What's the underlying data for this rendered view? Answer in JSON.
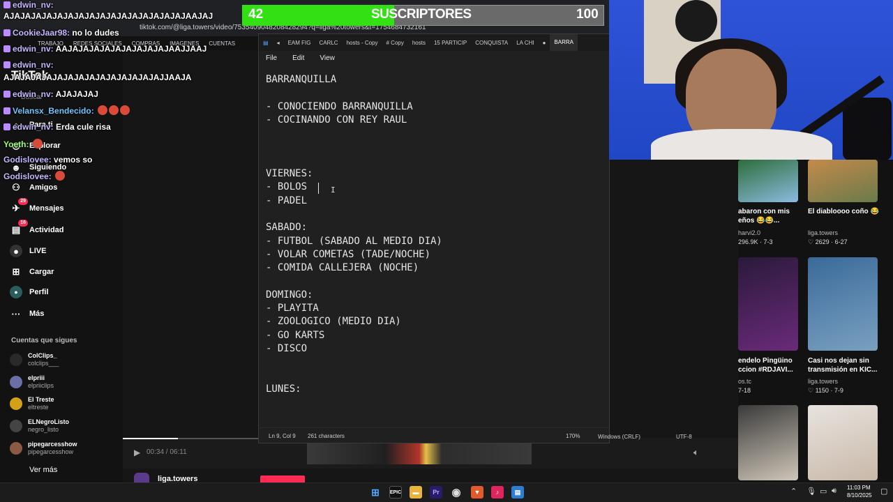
{
  "browser": {
    "url": "tiktok.com/@liga.towers/video/7535409048208428294?q=liga%20towers&t=1754684732161",
    "bookmarks": [
      "TRABAJO",
      "REDES SOCIALES",
      "COMPRAS",
      "IMAGENES",
      "CUENTAS"
    ]
  },
  "tiktok_sidebar": {
    "logo": "TikTok",
    "search_placeholder": "Buscar",
    "nav": [
      {
        "label": "Para ti",
        "icon": "home-icon"
      },
      {
        "label": "Explorar",
        "icon": "compass-icon"
      },
      {
        "label": "Siguiendo",
        "icon": "following-icon"
      },
      {
        "label": "Amigos",
        "icon": "friends-icon"
      },
      {
        "label": "Mensajes",
        "icon": "messages-icon",
        "badge": "29"
      },
      {
        "label": "Actividad",
        "icon": "activity-icon",
        "badge": "16"
      },
      {
        "label": "LIVE",
        "icon": "live-icon"
      },
      {
        "label": "Cargar",
        "icon": "upload-icon"
      },
      {
        "label": "Perfil",
        "icon": "profile-icon"
      },
      {
        "label": "Más",
        "icon": "more-icon"
      }
    ],
    "following_heading": "Cuentas que sigues",
    "following": [
      {
        "name": "ColClips_",
        "handle": "colclips___",
        "color": "#2a2a2a"
      },
      {
        "name": "elpriii",
        "handle": "elpriiclips",
        "color": "#6b6fa8"
      },
      {
        "name": "El Treste",
        "handle": "eltreste",
        "color": "#d4a017"
      },
      {
        "name": "ELNegroListo",
        "handle": "negro_listo",
        "color": "#444"
      },
      {
        "name": "pipegarcesshow",
        "handle": "pipegarcesshow",
        "color": "#8a5a44"
      }
    ],
    "see_more": "Ver más"
  },
  "video_player": {
    "time": "00:34 / 06:11",
    "progress": 0.09,
    "author": "liga.towers"
  },
  "notepad": {
    "tabs": [
      "EAM FIG",
      "CARLC",
      "hosts - Copy",
      "# Copy",
      "hosts",
      "15 PARTICIP",
      "CONQUISTA",
      "LA CHI",
      "BARRA"
    ],
    "active_tab": "BARRA",
    "menu": [
      "File",
      "Edit",
      "View"
    ],
    "lines": [
      "BARRANQUILLA",
      "",
      "- CONOCIENDO BARRANQUILLA",
      "- COCINANDO CON REY RAUL",
      "",
      "",
      "",
      "VIERNES:",
      "- BOLOS",
      "- PADEL",
      "",
      "SABADO:",
      "- FUTBOL (SABADO AL MEDIO DIA)",
      "- VOLAR COMETAS (TADE/NOCHE)",
      "- COMIDA CALLEJERA (NOCHE)",
      "",
      "DOMINGO:",
      "- PLAYITA",
      "- ZOOLOGICO (MEDIO DIA)",
      "- GO KARTS",
      "- DISCO",
      "",
      "",
      "LUNES:"
    ],
    "status": {
      "position": "Ln 9, Col 9",
      "characters": "261 characters",
      "zoom": "170%",
      "line_endings": "Windows (CRLF)",
      "encoding": "UTF-8"
    }
  },
  "sub_goal": {
    "current": "42",
    "label": "SUSCRIPTORES",
    "goal": "100",
    "fraction": 0.42
  },
  "chat": [
    {
      "user": "edwin_nv:",
      "msg": "",
      "gift": true
    },
    {
      "user": "",
      "msg": "AJAJAJAJAJAJAJAJAJAJAJAJAJAJAJAJAJAAJAJ"
    },
    {
      "user": "CookieJaar98:",
      "msg": "no lo dudes",
      "gift": true
    },
    {
      "user": "edwin_nv:",
      "msg": "AAJAJAJAJAJAJAJAJAJAJAAJJAAJ",
      "gift": true
    },
    {
      "user": "edwin_nv:",
      "msg": "",
      "gift": true
    },
    {
      "user": "",
      "msg": "AJAJAJAJAJAJAJAJAJAJAJAJAJAJAJJAAJA"
    },
    {
      "user": "edwin_nv:",
      "msg": "AJAJAJAJ",
      "gift": true
    },
    {
      "user": "Velansx_Bendecido:",
      "msg": "",
      "gift": true,
      "emotes": 3
    },
    {
      "user": "edwin_nv:",
      "msg": "Erda cule risa",
      "gift": true
    },
    {
      "user": "Yoeth:",
      "msg": "",
      "emotes": 1
    },
    {
      "user": "Godislovee:",
      "msg": "vemos so"
    },
    {
      "user": "Godislovee:",
      "msg": "",
      "emotes": 1
    }
  ],
  "feed_cards": [
    {
      "title": "",
      "author": "",
      "stats": "",
      "colors": [
        "#2d6d3a",
        "#8bbbe0"
      ]
    },
    {
      "title": "",
      "author": "",
      "stats": "",
      "colors": [
        "#c48a4a",
        "#6a7a4a"
      ]
    },
    {
      "title": "abaron con mis eños 😂😂...",
      "author": "harvi2.0",
      "stats": "296.9K · 7-3",
      "colors": [
        "#2a1a3a",
        "#6a2a7a"
      ]
    },
    {
      "title": "El diabloooo coño 😂",
      "author": "liga.towers",
      "stats": "2629 · 6-27",
      "colors": [
        "#3a6a9a",
        "#7aa0c0"
      ]
    },
    {
      "title": "endelo Pingüino ccion #RDJAVI...",
      "author": "os.tc",
      "stats": "7-18",
      "colors": [
        "#3a3a3a",
        "#cfc6b8"
      ]
    },
    {
      "title": "Casi nos dejan sin transmisión en KIC...",
      "author": "liga.towers",
      "stats": "1150 · 7-9",
      "colors": [
        "#e8e3df",
        "#c8b8a8"
      ]
    }
  ],
  "taskbar": {
    "time": "11:03 PM",
    "date": "8/10/2025"
  }
}
